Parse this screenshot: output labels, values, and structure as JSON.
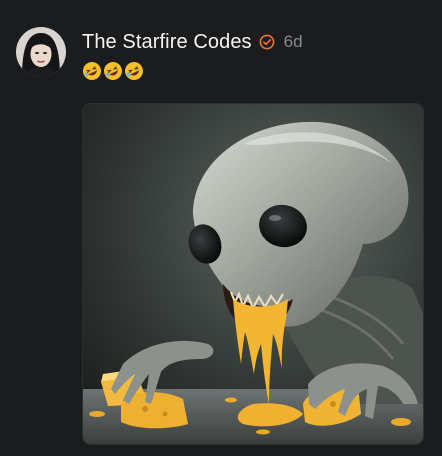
{
  "post": {
    "author_name": "The Starfire Codes",
    "verified_badge_icon": "verified-badge-icon",
    "timestamp": "6d",
    "reaction_text": "🤣🤣🤣",
    "avatar_icon": "avatar-portrait-icon",
    "media_icon": "alien-eating-cheese-image"
  },
  "colors": {
    "background": "#1b1c1e",
    "author_text": "#f4f4f4",
    "timestamp_text": "#8a8b8e",
    "verified_accent": "#e8743b",
    "cheese": "#f2b632"
  }
}
